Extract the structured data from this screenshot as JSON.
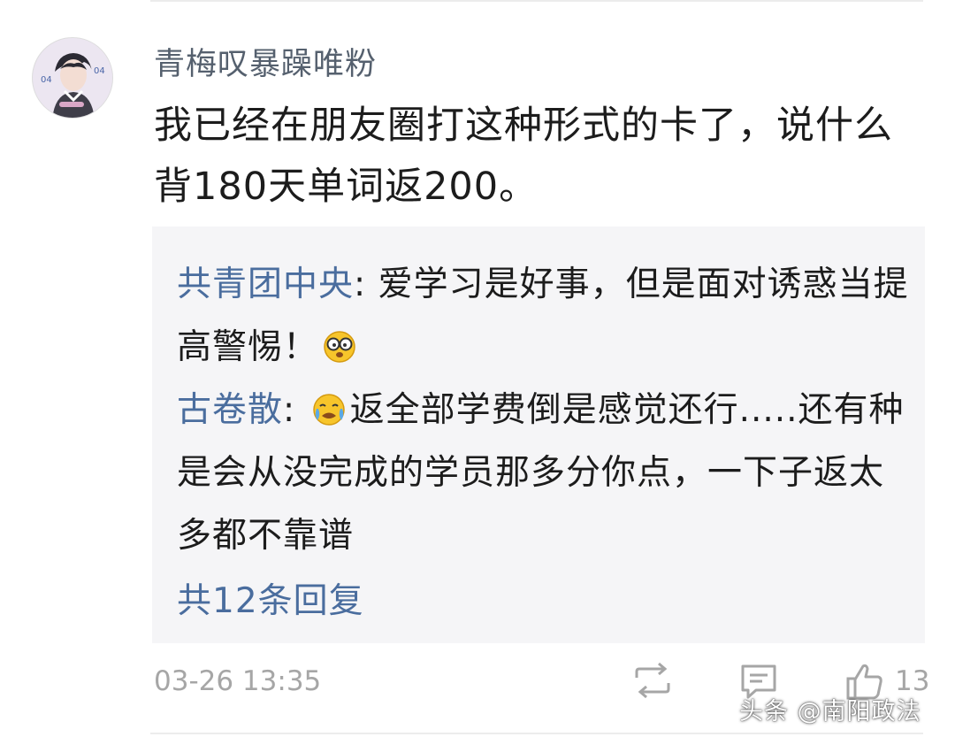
{
  "comment": {
    "username": "青梅叹暴躁唯粉",
    "text": "我已经在朋友圈打这种形式的卡了，说什么背180天单词返200。",
    "timestamp": "03-26 13:35",
    "like_count": "13"
  },
  "replies": [
    {
      "author": "共青团中央",
      "separator": ": ",
      "text": "爱学习是好事，但是面对诱惑当提高警惕！",
      "emoji_after": "glasses-face-emoji"
    },
    {
      "author": "古卷散",
      "separator": ": ",
      "emoji_before": "crying-face-emoji",
      "text": "返全部学费倒是感觉还行.....还有种是会从没完成的学员那多分你点，一下子返太多都不靠谱"
    }
  ],
  "more_replies": "共12条回复",
  "watermark": "头条 @南阳政法",
  "icons": {
    "share": "share-icon",
    "comment": "comment-icon",
    "like": "thumbs-up-icon"
  },
  "colors": {
    "username": "#55606e",
    "reply_author": "#4a6d9e",
    "meta": "#a6a6a6",
    "reply_background": "#f5f5f7"
  }
}
